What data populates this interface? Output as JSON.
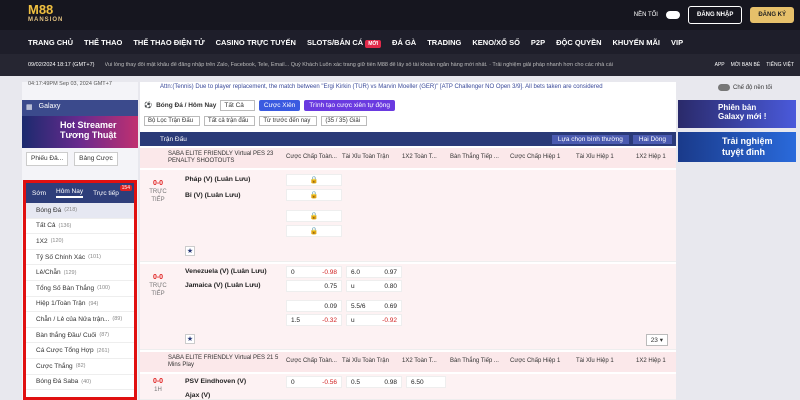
{
  "header": {
    "logo_top": "M88",
    "logo_bottom": "MANSION",
    "dark_mode_label": "NỀN TỐI",
    "login_label": "ĐĂNG NHẬP",
    "register_label": "ĐĂNG KÝ"
  },
  "nav": {
    "items": [
      "TRANG CHỦ",
      "THỂ THAO",
      "THỂ THAO ĐIỆN TỬ",
      "CASINO TRỰC TUYẾN",
      "SLOTS/BẮN CÁ",
      "ĐÁ GÀ",
      "TRADING",
      "KENO/XỔ SỐ",
      "P2P",
      "ĐỘC QUYỀN",
      "KHUYẾN MÃI",
      "VIP"
    ],
    "new_badge": "MỚI"
  },
  "ticker": {
    "datetime": "09/02/2024 18:17 (GMT+7)",
    "message": "Vui lòng thay đổi mật khẩu để đăng nhập trên Zalo, Facebook, Tele, Email... Quý Khách Luôn xác trang giữ tiền M88 để lấy số tài khoản ngân hàng mới nhất. · Trải nghiệm giải pháp nhanh hơn cho các nhà cái",
    "app": "APP",
    "invite": "MỜI BẠN BÈ",
    "lang": "TIẾNG VIỆT"
  },
  "left": {
    "time": "04:17:49PM Sep 03, 2024 GMT+7",
    "panel_title": "Galaxy",
    "banner_line1": "Hot Streamer",
    "banner_line2": "Tương Thuật",
    "tab_phieu": "Phiếu Đả...",
    "tab_bang": "Bảng Cược"
  },
  "dropdown": {
    "tabs": [
      "Sớm",
      "Hôm Nay",
      "Trực tiếp"
    ],
    "count": "154",
    "items": [
      {
        "label": "Bóng Đá",
        "n": "(218)"
      },
      {
        "label": "Tất Cả",
        "n": "(136)"
      },
      {
        "label": "1X2",
        "n": "(120)"
      },
      {
        "label": "Tỷ Số Chính Xác",
        "n": "(101)"
      },
      {
        "label": "Lẻ/Chẵn",
        "n": "(129)"
      },
      {
        "label": "Tổng Số Bàn Thắng",
        "n": "(100)"
      },
      {
        "label": "Hiệp 1/Toàn Trận",
        "n": "(94)"
      },
      {
        "label": "Chẵn / Lẻ của Nửa trận...",
        "n": "(89)"
      },
      {
        "label": "Bàn thắng Đầu/ Cuối",
        "n": "(87)"
      },
      {
        "label": "Cá Cược Tổng Hợp",
        "n": "(261)"
      },
      {
        "label": "Cược Thắng",
        "n": "(82)"
      },
      {
        "label": "Bóng Đá Saba",
        "n": "(40)"
      }
    ]
  },
  "main": {
    "notice": "Attn:(Tennis) Due to player replacement, the match between \"Ergi Kirkin (TUR)   vs   Marvin Moeller (GER)\" [ATP Challenger   NO Open   3/9]. All bets taken are considered",
    "sport_select": "Bóng Đá / Hôm Nay",
    "all_select": "Tất Cả",
    "xien_btn": "Cược Xiên",
    "custom_btn": "Trình tạo cược xiên tự động",
    "filter1": "Bộ Lọc Trận Đấu",
    "filter2": "Tất cả trận đấu",
    "filter3": "Từ trước đến nay",
    "filter4": "(35 / 35) Giải",
    "section": "Trận Đấu",
    "sort1": "Lựa chọn bình thường",
    "sort2": "Hai Dòng",
    "league1": "SABA ELITE FRIENDLY Virtual PES 23 PENALTY SHOOTOUTS",
    "league2": "SABA ELITE FRIENDLY Virtual PES 21 5 Mins Play",
    "cols": [
      "Cược Chấp Toàn...",
      "Tài Xỉu Toàn Trận",
      "1X2 Toàn T...",
      "Bàn Thắng Tiếp ...",
      "Cược Chấp Hiệp 1",
      "Tài Xỉu Hiệp 1",
      "1X2 Hiệp 1"
    ],
    "live": "TRỰC TIẾP",
    "score": "0-0",
    "m1_home": "Pháp (V) (Luân Lưu)",
    "m1_away": "Bỉ (V) (Luân Lưu)",
    "m2_home": "Venezuela (V) (Luân Lưu)",
    "m2_away": "Jamaica (V) (Luân Lưu)",
    "m2_row1": {
      "h": "0",
      "o": "-0.98",
      "t": "6.0",
      "to": "0.97"
    },
    "m2_row2": {
      "o": "0.75",
      "t": "u",
      "to": "0.80"
    },
    "m2_row3": {
      "o": "0.09",
      "t": "5.5/6",
      "to": "0.69"
    },
    "m2_row4": {
      "h": "1.5",
      "o": "-0.32",
      "t": "u",
      "to": "-0.92"
    },
    "m3_home": "PSV Eindhoven (V)",
    "m3_away": "Ajax (V)",
    "m3_row1": {
      "h": "0",
      "o": "-0.56",
      "t": "0.5",
      "to": "0.98",
      "x": "6.50"
    },
    "m3_live": "1H",
    "page_select": "23"
  },
  "right": {
    "tv_label": "Chế độ nền tối",
    "b1_line1": "Phiên bản",
    "b1_line2": "Galaxy mới !",
    "b2_line1": "Trải nghiệm",
    "b2_line2": "tuyệt đỉnh"
  }
}
